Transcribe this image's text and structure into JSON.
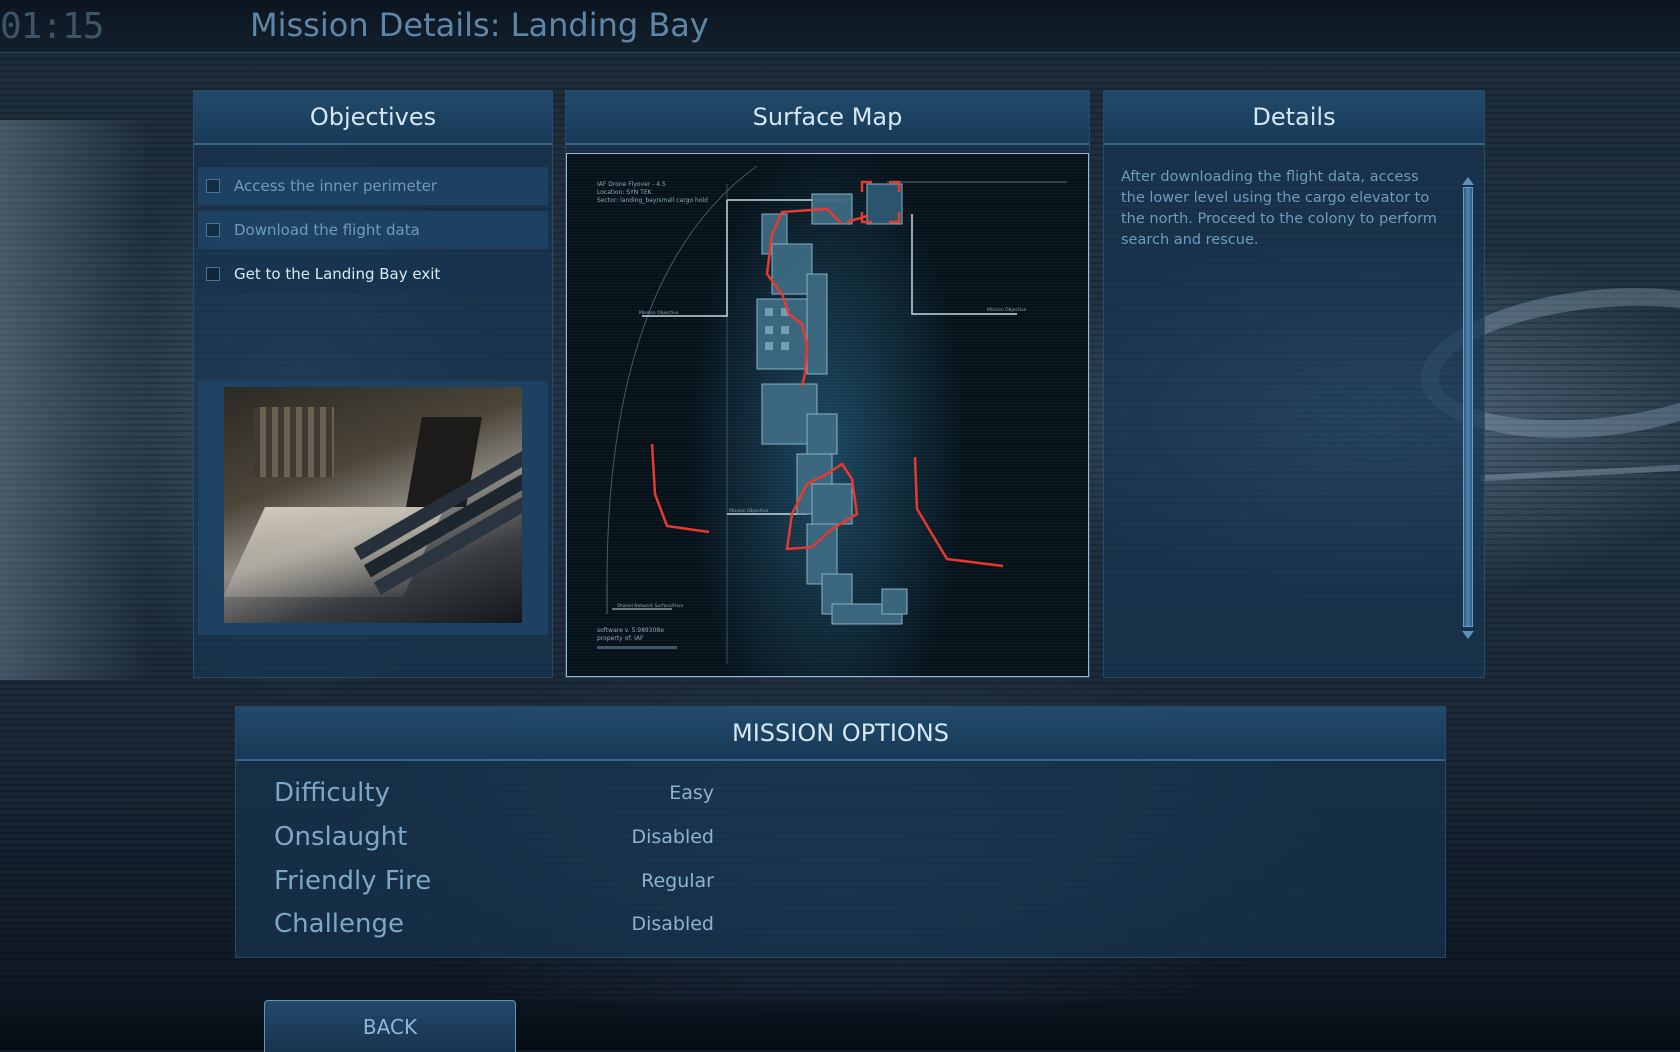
{
  "header": {
    "timer": "01:15",
    "title": "Mission Details: Landing Bay"
  },
  "objectives": {
    "title": "Objectives",
    "items": [
      {
        "label": "Access the inner perimeter",
        "active": false
      },
      {
        "label": "Download the flight data",
        "active": false
      },
      {
        "label": "Get to the Landing Bay exit",
        "active": true
      }
    ]
  },
  "surface_map": {
    "title": "Surface Map",
    "info_lines": [
      "IAF Drone Flyover - 4.5",
      "Location: SYN TEK",
      "Sector: landing_bay/small cargo hold"
    ],
    "labels": [
      "Mission Objective",
      "Mission Objective",
      "Mission Objective",
      "Shared Network Surface/Hive"
    ],
    "footer_lines": [
      "software v. 5.989308e",
      "property of: IAF"
    ],
    "route_color": "#e8392f"
  },
  "details": {
    "title": "Details",
    "text": "After downloading the flight data, access the lower level using the cargo elevator to the north.  Proceed to the colony to perform search and rescue."
  },
  "mission_options": {
    "title": "MISSION OPTIONS",
    "rows": [
      {
        "label": "Difficulty",
        "value": "Easy"
      },
      {
        "label": "Onslaught",
        "value": "Disabled"
      },
      {
        "label": "Friendly Fire",
        "value": "Regular"
      },
      {
        "label": "Challenge",
        "value": "Disabled"
      }
    ]
  },
  "back_button": {
    "label": "BACK"
  }
}
